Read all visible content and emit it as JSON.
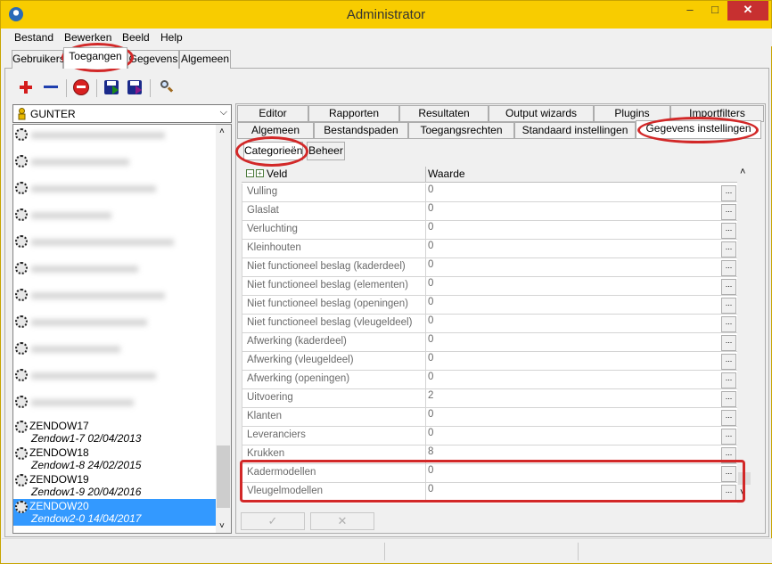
{
  "window": {
    "title": "Administrator"
  },
  "menu": {
    "items": [
      "Bestand",
      "Bewerken",
      "Beeld",
      "Help"
    ]
  },
  "main_tabs": [
    "Gebruikers",
    "Toegangen",
    "Gegevens",
    "Algemeen"
  ],
  "main_tabs_active": "Toegangen",
  "toolbar": {
    "icons": [
      "add-icon",
      "remove-icon",
      "delete-icon",
      "import-icon",
      "export-icon",
      "search-icon"
    ]
  },
  "user_select": {
    "value": "GUNTER"
  },
  "users": [
    {
      "name": "ZENDOW17",
      "desc": "Zendow1-7 02/04/2013"
    },
    {
      "name": "ZENDOW18",
      "desc": "Zendow1-8 24/02/2015"
    },
    {
      "name": "ZENDOW19",
      "desc": "Zendow1-9 20/04/2016"
    },
    {
      "name": "ZENDOW20",
      "desc": "Zendow2-0 14/04/2017",
      "selected": true
    }
  ],
  "right_tabs_row1": [
    "Editor",
    "Rapporten",
    "Resultaten",
    "Output wizards",
    "Plugins",
    "Importfilters"
  ],
  "right_tabs_row2": [
    "Algemeen",
    "Bestandspaden",
    "Toegangsrechten",
    "Standaard instellingen",
    "Gegevens instellingen"
  ],
  "right_tabs_active": "Gegevens instellingen",
  "sub_tabs": [
    "Categorieën",
    "Beheer"
  ],
  "sub_tabs_active": "Categorieën",
  "grid": {
    "headers": {
      "veld": "Veld",
      "waarde": "Waarde"
    },
    "button_label": "...",
    "rows": [
      {
        "veld": "Vulling",
        "waarde": "0"
      },
      {
        "veld": "Glaslat",
        "waarde": "0"
      },
      {
        "veld": "Verluchting",
        "waarde": "0"
      },
      {
        "veld": "Kleinhouten",
        "waarde": "0"
      },
      {
        "veld": "Niet functioneel beslag (kaderdeel)",
        "waarde": "0"
      },
      {
        "veld": "Niet functioneel beslag (elementen)",
        "waarde": "0"
      },
      {
        "veld": "Niet functioneel beslag (openingen)",
        "waarde": "0"
      },
      {
        "veld": "Niet functioneel beslag (vleugeldeel)",
        "waarde": "0"
      },
      {
        "veld": "Afwerking (kaderdeel)",
        "waarde": "0"
      },
      {
        "veld": "Afwerking (vleugeldeel)",
        "waarde": "0"
      },
      {
        "veld": "Afwerking (openingen)",
        "waarde": "0"
      },
      {
        "veld": "Uitvoering",
        "waarde": "2"
      },
      {
        "veld": "Klanten",
        "waarde": "0"
      },
      {
        "veld": "Leveranciers",
        "waarde": "0"
      },
      {
        "veld": "Krukken",
        "waarde": "8"
      },
      {
        "veld": "Kadermodellen",
        "waarde": "0"
      },
      {
        "veld": "Vleugelmodellen",
        "waarde": "0"
      }
    ]
  },
  "actions": {
    "confirm_icon": "check-icon",
    "cancel_icon": "cross-icon",
    "confirm_glyph": "✓",
    "cancel_glyph": "✕"
  },
  "colors": {
    "titlebar": "#f8cc00",
    "selection": "#3399ff",
    "annotation": "#d22828"
  }
}
